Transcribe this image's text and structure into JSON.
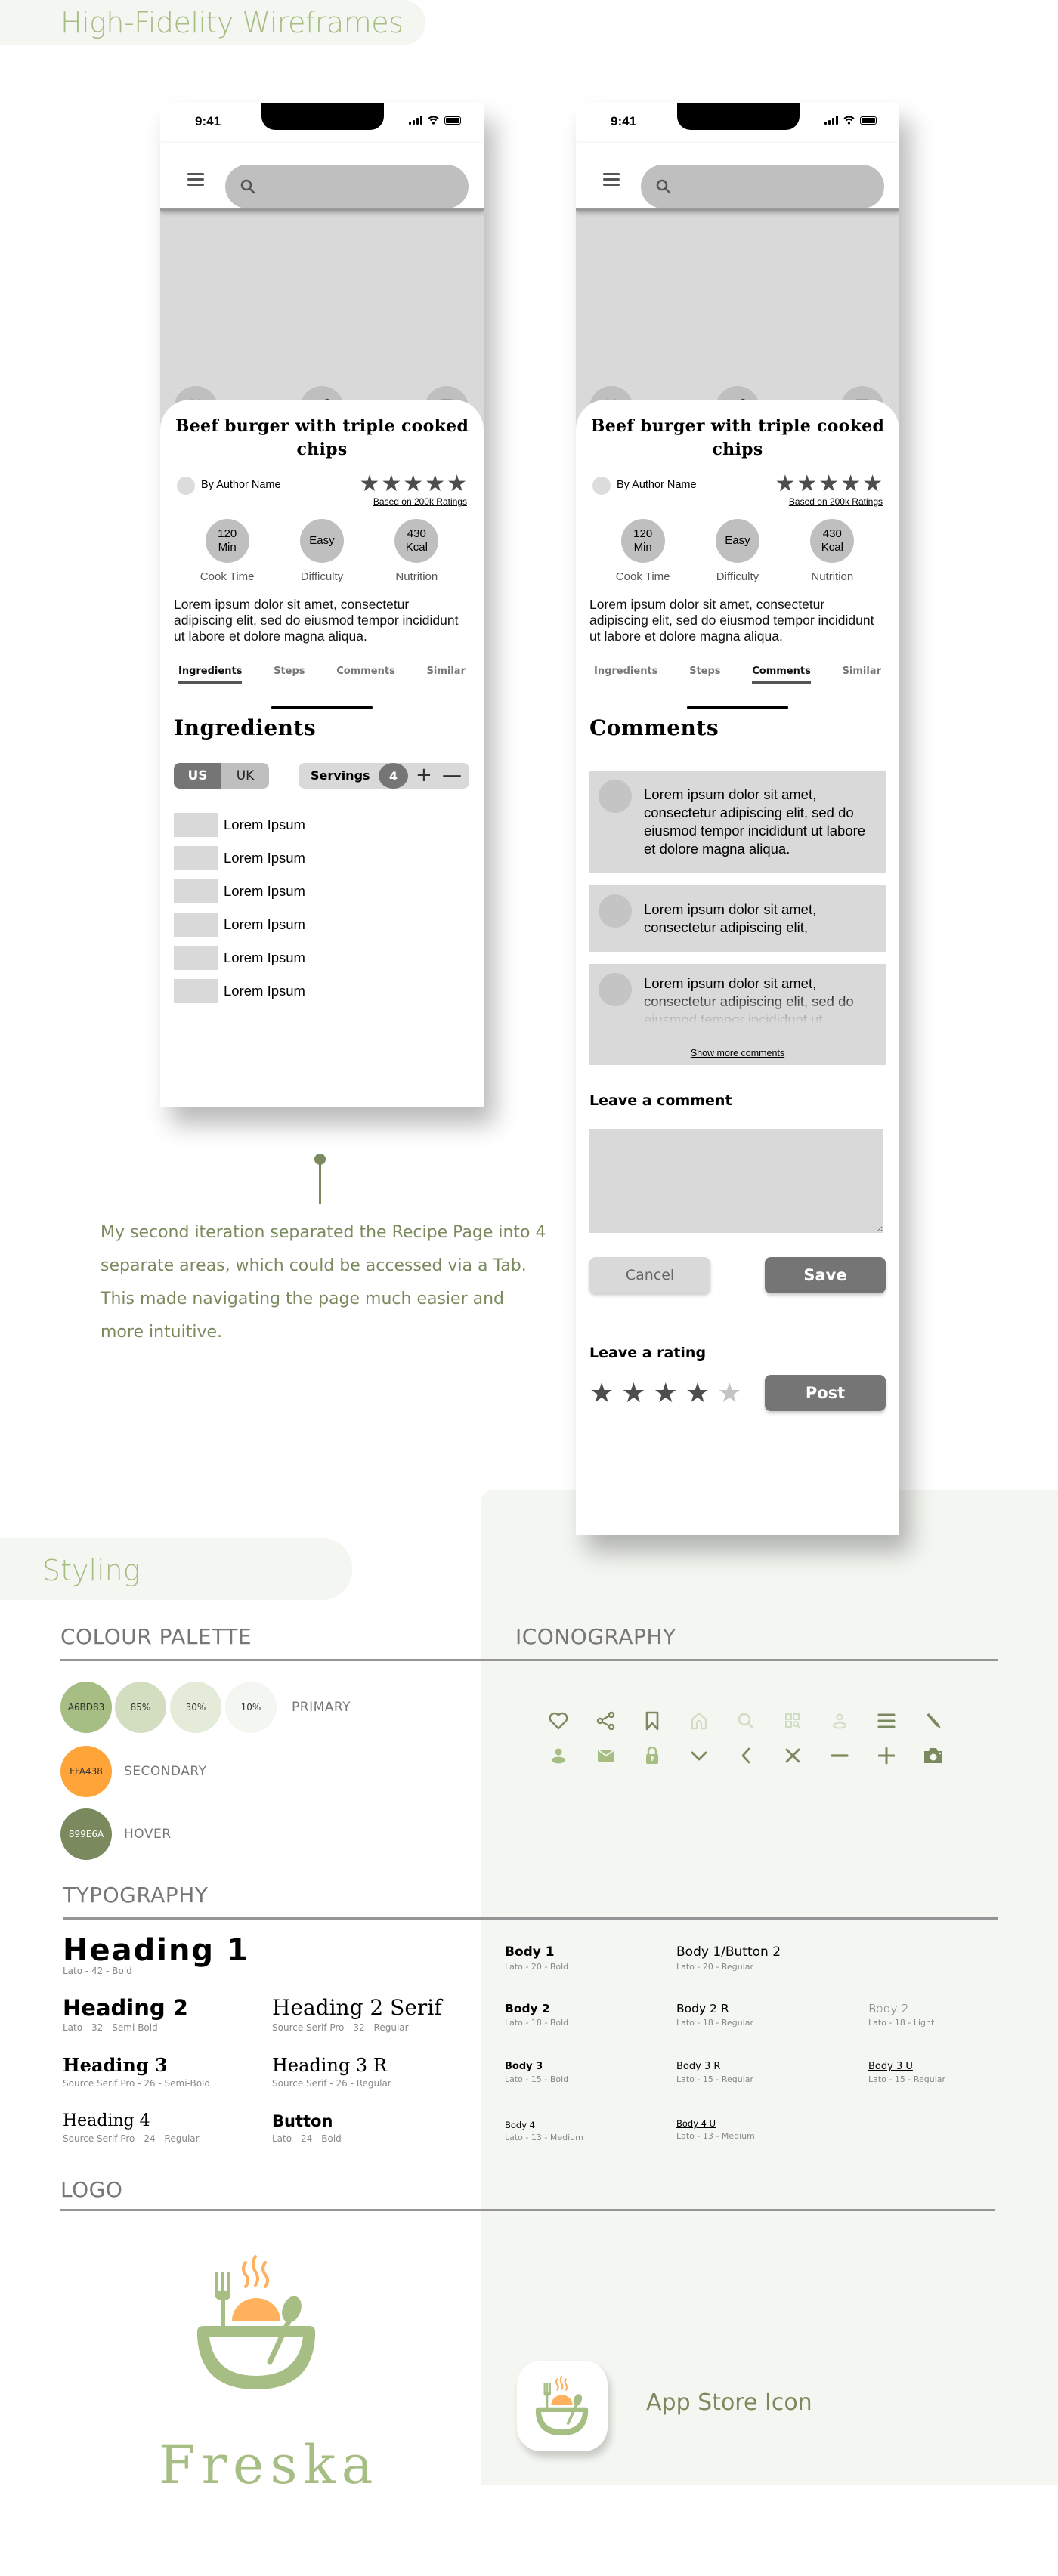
{
  "banners": {
    "wireframes": "High-Fidelity Wireframes",
    "styling": "Styling"
  },
  "colors": {
    "primary": "#A6BD83",
    "primary_85": "#D3DEC1",
    "primary_30": "#E4EBD9",
    "primary_10": "#F4F6F1",
    "secondary": "#FFA438",
    "hover": "#899E6A"
  },
  "phone": {
    "time": "9:41",
    "recipe_title": "Beef burger with triple cooked chips",
    "author": "By Author Name",
    "rating_stars": 5,
    "ratings_link": "Based on 200k Ratings",
    "stats": [
      {
        "value": "120\nMin",
        "label": "Cook Time"
      },
      {
        "value": "Easy",
        "label": "Difficulty"
      },
      {
        "value": "430\nKcal",
        "label": "Nutrition"
      }
    ],
    "description": "Lorem ipsum dolor sit amet, consectetur adipiscing elit, sed do eiusmod tempor incididunt ut labore et dolore magna aliqua.",
    "tabs": [
      "Ingredients",
      "Steps",
      "Comments",
      "Similar"
    ]
  },
  "left_phone": {
    "active_tab": "Ingredients",
    "section_title": "Ingredients",
    "units": [
      "US",
      "UK"
    ],
    "selected_unit": "US",
    "servings_label": "Servings",
    "servings_count": "4",
    "plus": "+",
    "minus": "—",
    "ingredients": [
      "Lorem Ipsum",
      "Lorem Ipsum",
      "Lorem Ipsum",
      "Lorem Ipsum",
      "Lorem Ipsum",
      "Lorem Ipsum"
    ]
  },
  "right_phone": {
    "active_tab": "Comments",
    "section_title": "Comments",
    "comments": [
      "Lorem ipsum dolor sit amet, consectetur adipiscing elit, sed do eiusmod tempor incididunt ut labore et dolore magna aliqua.",
      "Lorem ipsum dolor sit amet, consectetur adipiscing elit,",
      "Lorem ipsum dolor sit amet, consectetur adipiscing elit, sed do eiusmod tempor incididunt ut"
    ],
    "show_more": "Show more comments",
    "leave_comment_title": "Leave a comment",
    "comment_value": "",
    "cancel_label": "Cancel",
    "save_label": "Save",
    "leave_rating_title": "Leave a rating",
    "user_rating": 4,
    "rating_max": 5,
    "post_label": "Post"
  },
  "annotation": "My second iteration separated the Recipe Page into 4 separate areas, which could be accessed via a Tab. This made navigating the page much easier and more intuitive.",
  "styling": {
    "colour_palette_title": "COLOUR PALETTE",
    "iconography_title": "ICONOGRAPHY",
    "typography_title": "TYPOGRAPHY",
    "logo_title": "LOGO",
    "palette": {
      "primary": [
        {
          "label": "A6BD83",
          "color": "#A6BD83"
        },
        {
          "label": "85%",
          "color": "#D3DEC1"
        },
        {
          "label": "30%",
          "color": "#E4EBD9"
        },
        {
          "label": "10%",
          "color": "#F4F6F1"
        }
      ],
      "primary_label": "PRIMARY",
      "secondary": {
        "label": "FFA438",
        "color": "#FFA438"
      },
      "secondary_label": "SECONDARY",
      "hover": {
        "label": "899E6A",
        "color": "#7A8A5E"
      },
      "hover_label": "HOVER"
    },
    "icons": [
      [
        "heart-icon",
        "share-icon",
        "bookmark-icon",
        "home-icon",
        "search-icon",
        "qr-search-icon",
        "user-outline-icon",
        "menu-icon",
        "pencil-icon"
      ],
      [
        "user-icon",
        "mail-icon",
        "lock-icon",
        "chevron-down-icon",
        "chevron-left-icon",
        "close-icon",
        "minus-icon",
        "plus-icon",
        "camera-icon"
      ]
    ],
    "typography_left": [
      {
        "sample": "Heading 1",
        "spec": "Lato - 42 - Bold"
      },
      {
        "sample": "Heading 2",
        "spec": "Lato - 32 - Semi-Bold"
      },
      {
        "sample": "Heading 2 Serif",
        "spec": "Source Serif Pro - 32 - Regular"
      },
      {
        "sample": "Heading 3",
        "spec": "Source Serif Pro - 26 - Semi-Bold"
      },
      {
        "sample": "Heading 3 R",
        "spec": "Source Serif - 26 - Regular"
      },
      {
        "sample": "Heading 4",
        "spec": "Source Serif Pro - 24 - Regular"
      },
      {
        "sample": "Button",
        "spec": "Lato - 24 - Bold"
      }
    ],
    "typography_right": [
      {
        "sample": "Body 1",
        "spec": "Lato - 20 - Bold"
      },
      {
        "sample": "Body 1/Button 2",
        "spec": "Lato - 20 - Regular"
      },
      {
        "sample": "Body 2",
        "spec": "Lato - 18 - Bold"
      },
      {
        "sample": "Body 2 R",
        "spec": "Lato - 18 - Regular"
      },
      {
        "sample": "Body 2 L",
        "spec": "Lato - 18 - Light"
      },
      {
        "sample": "Body 3",
        "spec": "Lato - 15 - Bold"
      },
      {
        "sample": "Body 3 R",
        "spec": "Lato - 15 - Regular"
      },
      {
        "sample": "Body 3 U",
        "spec": "Lato - 15 - Regular"
      },
      {
        "sample": "Body 4",
        "spec": "Lato - 13 - Medium"
      },
      {
        "sample": "Body 4 U",
        "spec": "Lato - 13 - Medium"
      }
    ],
    "logo_word": "Freska",
    "app_store_label": "App Store Icon"
  }
}
